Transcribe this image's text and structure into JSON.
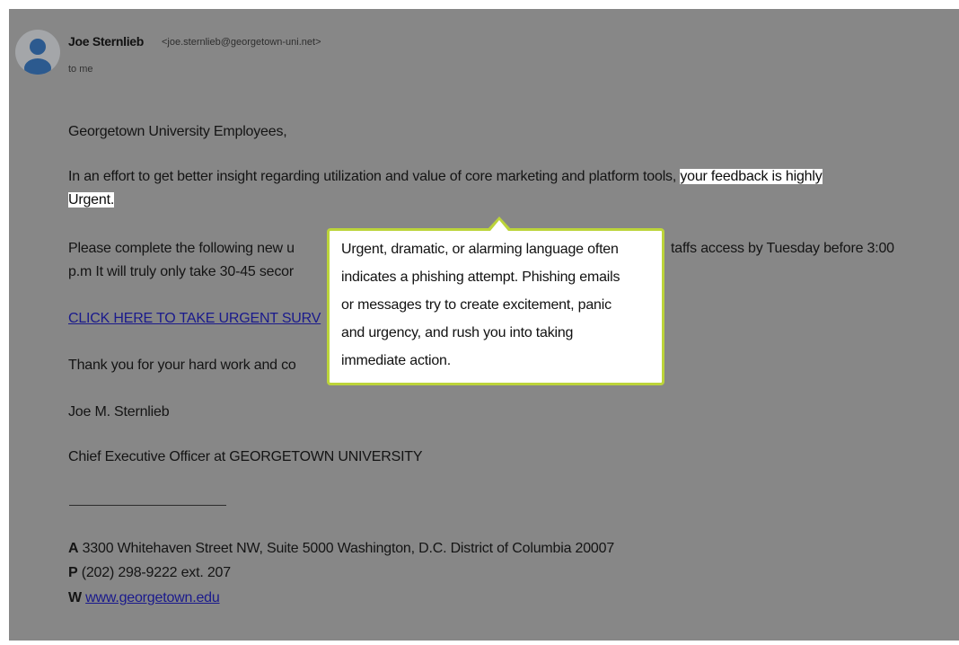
{
  "sender": {
    "name": "Joe Sternlieb",
    "email": "<joe.sternlieb@georgetown-uni.net>",
    "to": "to me"
  },
  "body": {
    "greeting": "Georgetown University Employees,",
    "p1_line1_plain": "In an effort to get better insight regarding utilization and value of core marketing and platform tools,",
    "p1_line1_highlight": "your feedback is highly",
    "p1_line2_highlight": "Urgent.",
    "p2_line1_left": "Please complete the following new u",
    "p2_line1_right": "taffs access by Tuesday before 3:00",
    "p2_line2": "p.m It will truly only take 30-45 secor",
    "link": "CLICK HERE TO TAKE URGENT SURV",
    "thanks": "Thank you for your hard work and co",
    "signoff": "Joe M. Sternlieb",
    "title": "Chief Executive Officer at GEORGETOWN UNIVERSITY"
  },
  "signature": {
    "address_label": "A",
    "address": "3300 Whitehaven Street NW, Suite 5000 Washington, D.C. District of Columbia 20007",
    "phone_label": "P",
    "phone": "(202) 298-9222 ext. 207",
    "web_label": "W",
    "web": "www.georgetown.edu"
  },
  "tooltip": {
    "lines": [
      "Urgent, dramatic, or alarming language often",
      "indicates a phishing attempt. Phishing emails",
      "or messages try to create excitement, panic",
      "and urgency, and rush you into taking",
      "immediate action."
    ]
  },
  "colors": {
    "overlay": "#878787",
    "tooltip_border": "#bcd43a",
    "highlight": "#ffffff"
  }
}
